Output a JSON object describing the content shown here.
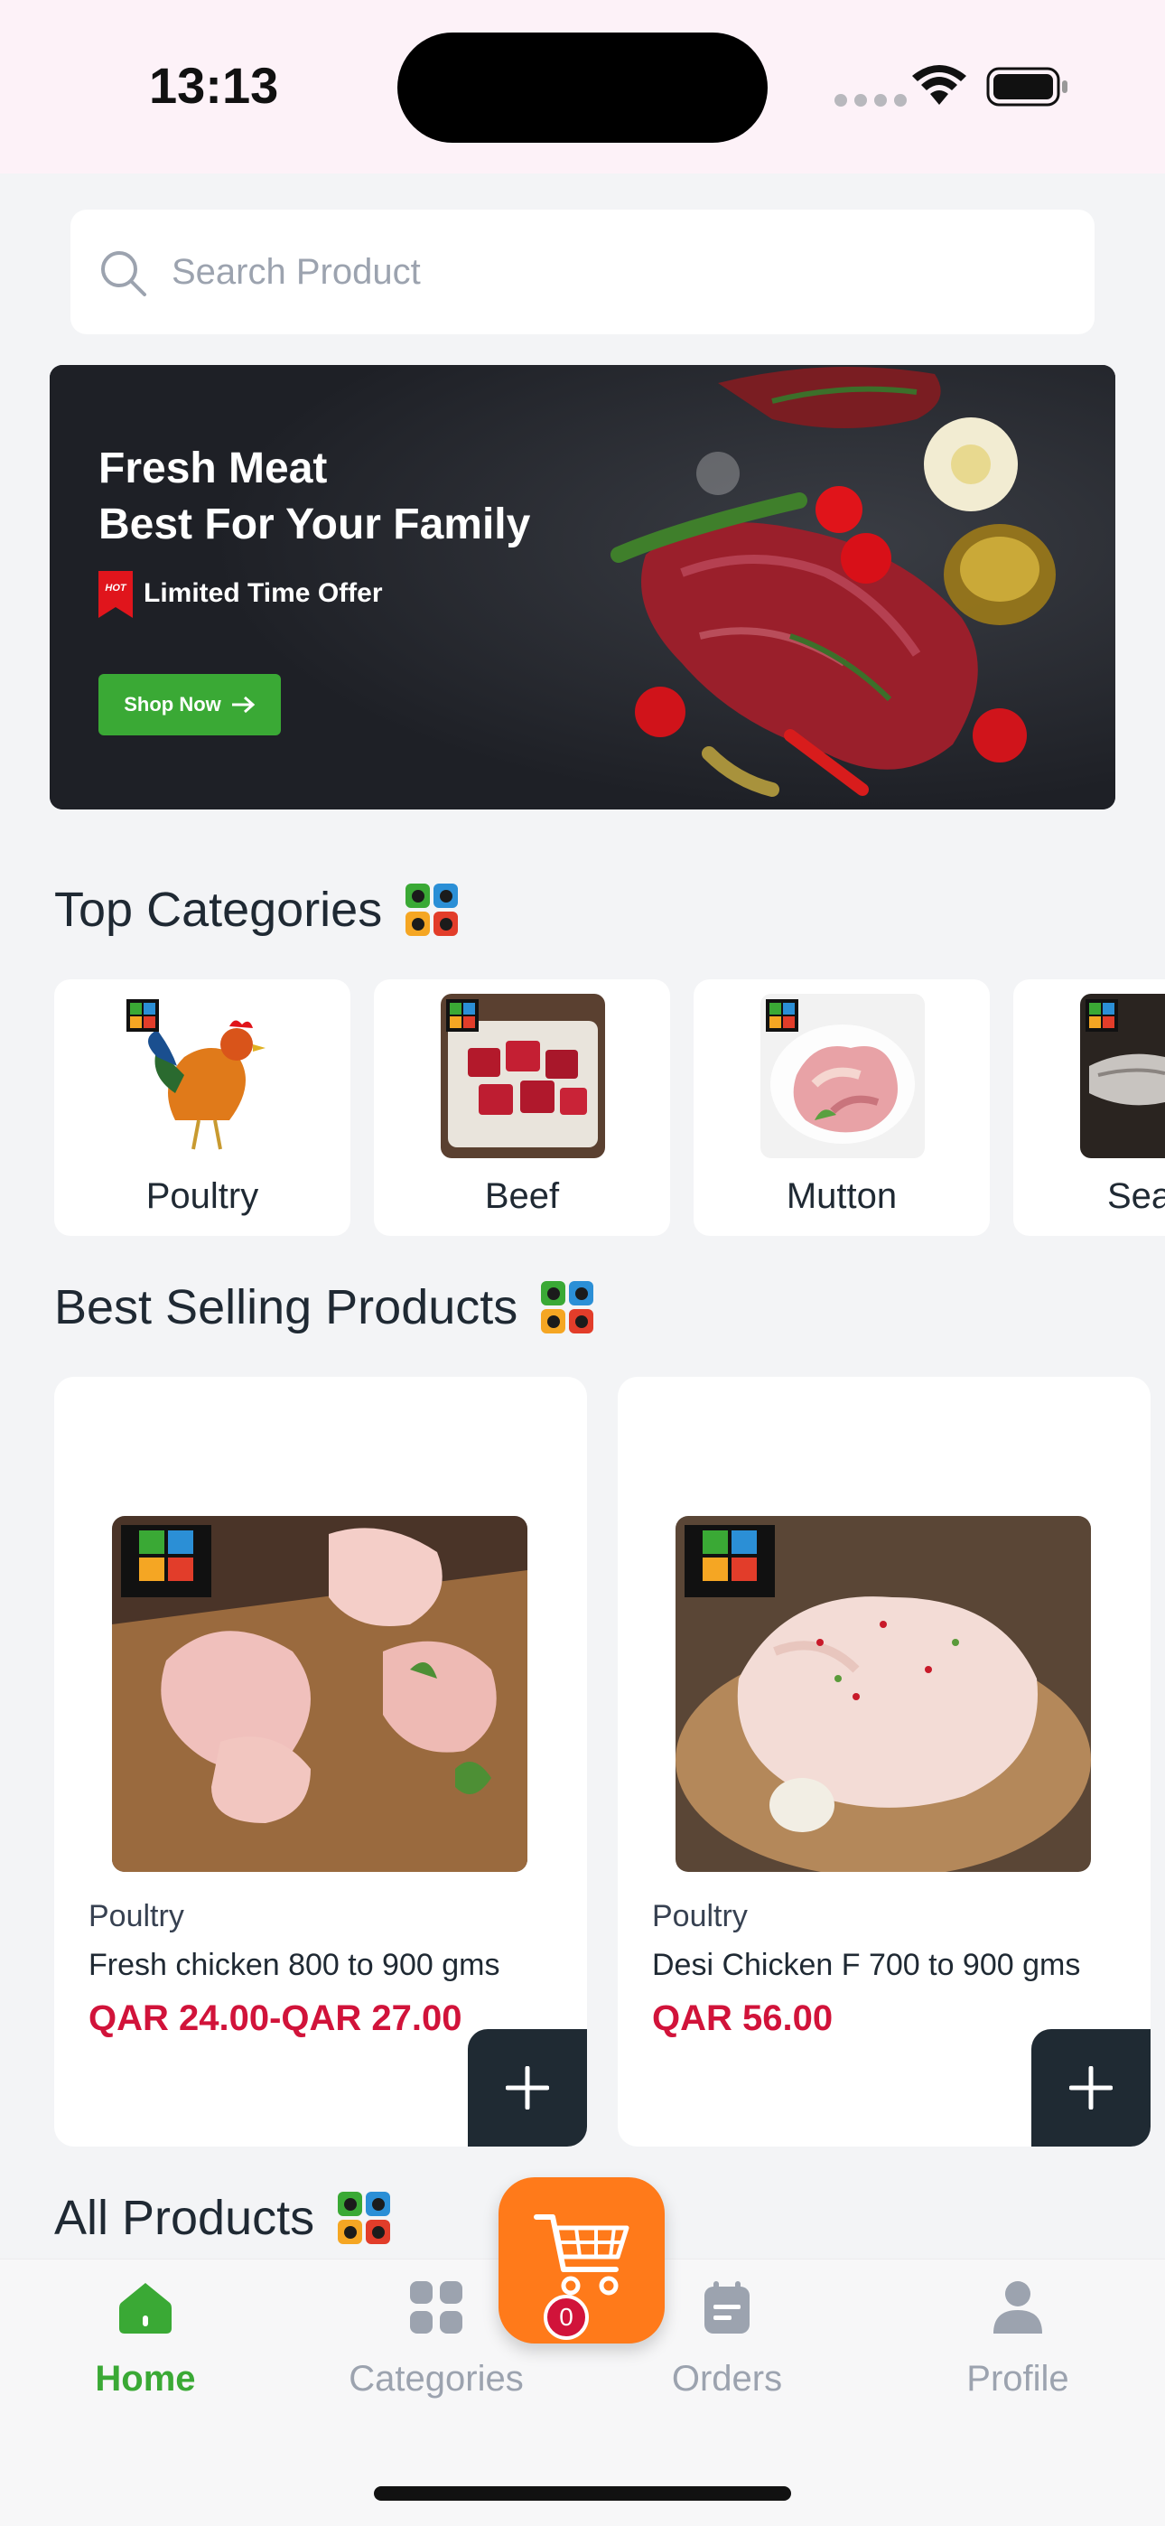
{
  "status_bar": {
    "time": "13:13"
  },
  "search": {
    "placeholder": "Search Product"
  },
  "banner": {
    "title_line1": "Fresh Meat",
    "title_line2": "Best For Your Family",
    "offer_text": "Limited Time Offer",
    "hot_badge": "HOT",
    "button_label": "Shop Now"
  },
  "top_categories": {
    "title": "Top Categories",
    "items": [
      {
        "label": "Poultry"
      },
      {
        "label": "Beef"
      },
      {
        "label": "Mutton"
      },
      {
        "label": "Seaf"
      }
    ]
  },
  "best_selling": {
    "title": "Best Selling Products",
    "products": [
      {
        "category": "Poultry",
        "name": "Fresh chicken 800 to 900 gms",
        "price": "QAR 24.00-QAR 27.00"
      },
      {
        "category": "Poultry",
        "name": "Desi Chicken F 700 to 900 gms",
        "price": "QAR 56.00"
      }
    ]
  },
  "all_products": {
    "title": "All Products"
  },
  "bottom_nav": {
    "items": [
      {
        "label": "Home",
        "icon": "home-icon",
        "active": true
      },
      {
        "label": "Categories",
        "icon": "grid-icon",
        "active": false
      },
      {
        "label": "Orders",
        "icon": "orders-icon",
        "active": false
      },
      {
        "label": "Profile",
        "icon": "profile-icon",
        "active": false
      }
    ]
  },
  "cart": {
    "count": "0"
  },
  "colors": {
    "accent_green": "#3aa935",
    "price_red": "#d1133a",
    "cart_orange": "#ff7a1a",
    "dark": "#1f2a33"
  }
}
